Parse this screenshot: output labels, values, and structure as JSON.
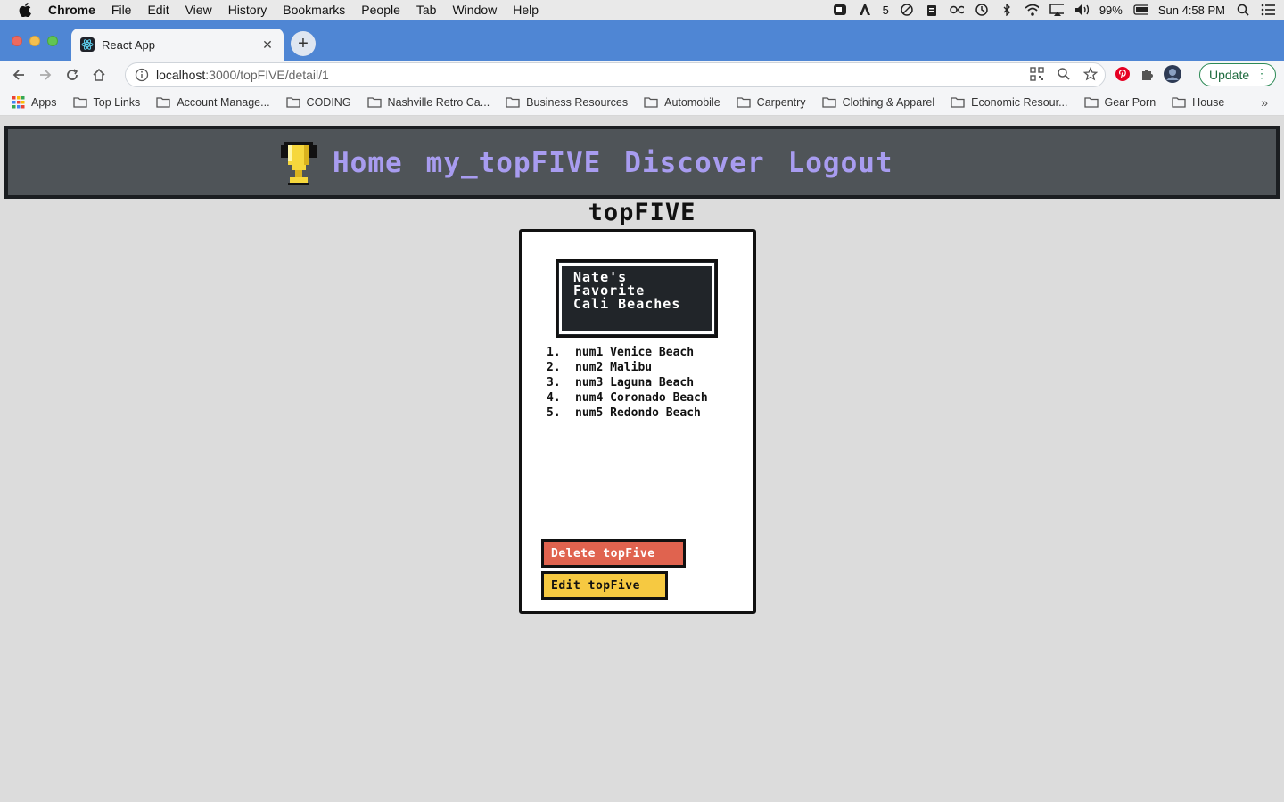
{
  "menubar": {
    "app_name": "Chrome",
    "items": [
      "File",
      "Edit",
      "View",
      "History",
      "Bookmarks",
      "People",
      "Tab",
      "Window",
      "Help"
    ],
    "status": {
      "adobe_count": "5",
      "battery": "99%",
      "clock": "Sun 4:58 PM"
    }
  },
  "browser": {
    "tab_title": "React App",
    "url_host": "localhost",
    "url_path": ":3000/topFIVE/detail/1",
    "update_label": "Update"
  },
  "bookmarks": {
    "apps_label": "Apps",
    "items": [
      "Top Links",
      "Account Manage...",
      "CODING",
      "Nashville Retro Ca...",
      "Business Resources",
      "Automobile",
      "Carpentry",
      "Clothing & Apparel",
      "Economic Resour...",
      "Gear Porn",
      "House"
    ]
  },
  "nav": {
    "links": [
      "Home",
      "my_topFIVE",
      "Discover",
      "Logout"
    ]
  },
  "site_title": "topFIVE",
  "card": {
    "title": "Nate's Favorite Cali Beaches",
    "items": [
      {
        "num": "1.",
        "text": "num1 Venice Beach"
      },
      {
        "num": "2.",
        "text": "num2 Malibu"
      },
      {
        "num": "3.",
        "text": "num3 Laguna Beach"
      },
      {
        "num": "4.",
        "text": "num4 Coronado Beach"
      },
      {
        "num": "5.",
        "text": "num5 Redondo Beach"
      }
    ],
    "delete_label": "Delete topFive",
    "edit_label": "Edit topFive"
  },
  "colors": {
    "navbar_bg": "#4f5458",
    "nav_link": "#a89cf0",
    "delete_btn": "#e0634f",
    "edit_btn": "#f6c941",
    "chrome_tabstrip": "#4f86d4"
  }
}
